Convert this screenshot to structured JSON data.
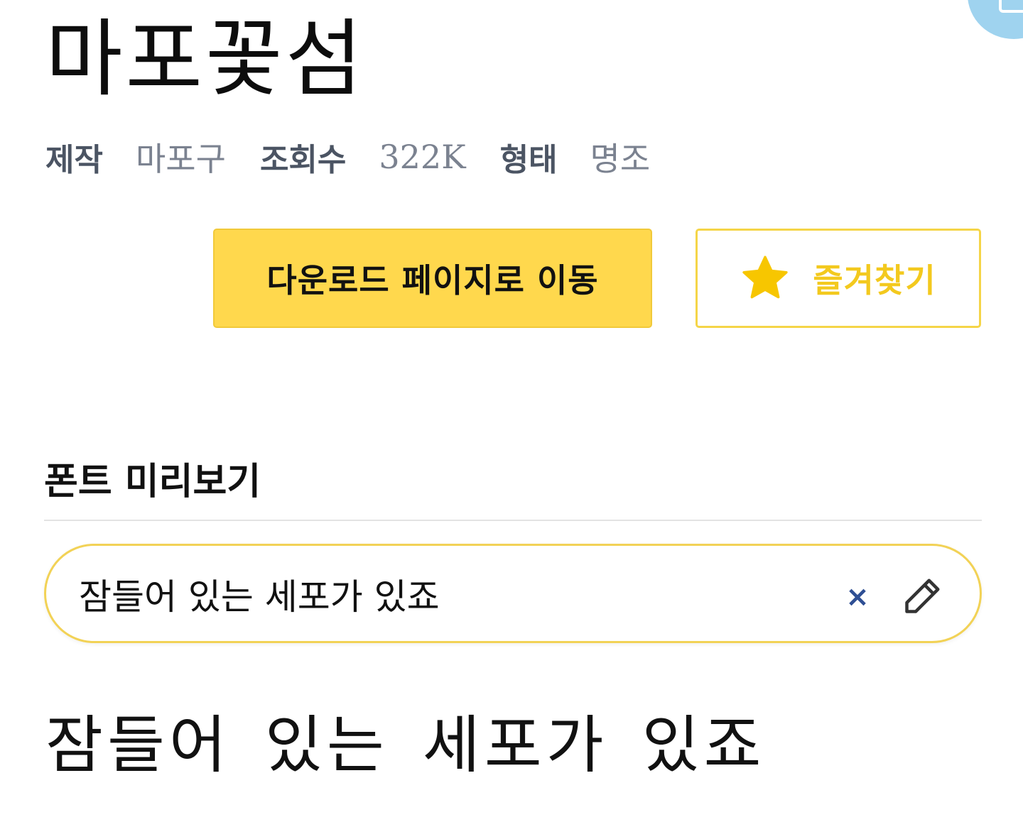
{
  "font": {
    "name": "마포꽃섬"
  },
  "meta": {
    "maker_label": "제작",
    "maker_value": "마포구",
    "views_label": "조회수",
    "views_value": "322K",
    "type_label": "형태",
    "type_value": "명조"
  },
  "actions": {
    "download_label": "다운로드 페이지로 이동",
    "favorite_label": "즐겨찾기",
    "favorite_icon": "star-icon"
  },
  "preview": {
    "section_title": "폰트 미리보기",
    "input_value": "잠들어 있는 세포가 있죠",
    "clear_label": "×",
    "clear_icon": "close-icon",
    "edit_icon": "pencil-icon",
    "rendered_text": "잠들어 있는 세포가 있죠"
  },
  "colors": {
    "accent_yellow": "#ffd84d",
    "favorite_text": "#f3c91e",
    "meta_label": "#4b5463",
    "meta_value": "#7b8290",
    "clear_icon": "#2f4f94",
    "corner_badge": "#9fd3ef"
  }
}
